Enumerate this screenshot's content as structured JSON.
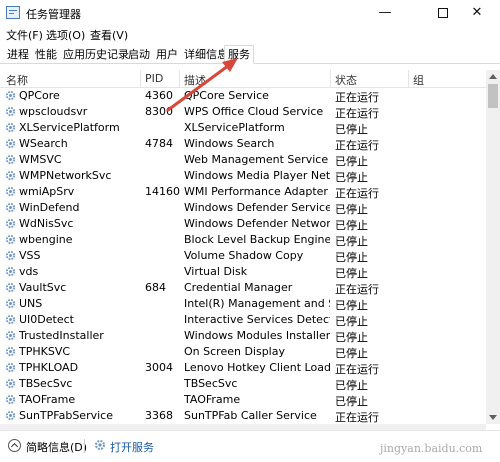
{
  "window": {
    "title": "任务管理器",
    "minimize": "—",
    "close": "✕"
  },
  "menu": [
    "文件(F)",
    "选项(O)",
    "查看(V)"
  ],
  "tabs": [
    "进程",
    "性能",
    "应用历史记录",
    "启动",
    "用户",
    "详细信息",
    "服务"
  ],
  "active_tab": "服务",
  "columns": {
    "name": "名称",
    "pid": "PID",
    "desc": "描述",
    "status": "状态",
    "group": "组"
  },
  "rows": [
    {
      "name": "QPCore",
      "pid": "4360",
      "desc": "QPCore Service",
      "status": "正在运行"
    },
    {
      "name": "wpscloudsvr",
      "pid": "8300",
      "desc": "WPS Office Cloud Service",
      "status": "正在运行"
    },
    {
      "name": "XLServicePlatform",
      "pid": "",
      "desc": "XLServicePlatform",
      "status": "已停止"
    },
    {
      "name": "WSearch",
      "pid": "4784",
      "desc": "Windows Search",
      "status": "正在运行"
    },
    {
      "name": "WMSVC",
      "pid": "",
      "desc": "Web Management Service",
      "status": "已停止"
    },
    {
      "name": "WMPNetworkSvc",
      "pid": "",
      "desc": "Windows Media Player Netw...",
      "status": "已停止"
    },
    {
      "name": "wmiApSrv",
      "pid": "14160",
      "desc": "WMI Performance Adapter",
      "status": "正在运行"
    },
    {
      "name": "WinDefend",
      "pid": "",
      "desc": "Windows Defender Service",
      "status": "已停止"
    },
    {
      "name": "WdNisSvc",
      "pid": "",
      "desc": "Windows Defender Network I...",
      "status": "已停止"
    },
    {
      "name": "wbengine",
      "pid": "",
      "desc": "Block Level Backup Engine Se...",
      "status": "已停止"
    },
    {
      "name": "VSS",
      "pid": "",
      "desc": "Volume Shadow Copy",
      "status": "已停止"
    },
    {
      "name": "vds",
      "pid": "",
      "desc": "Virtual Disk",
      "status": "已停止"
    },
    {
      "name": "VaultSvc",
      "pid": "684",
      "desc": "Credential Manager",
      "status": "正在运行"
    },
    {
      "name": "UNS",
      "pid": "",
      "desc": "Intel(R) Management and Sec...",
      "status": "已停止"
    },
    {
      "name": "UI0Detect",
      "pid": "",
      "desc": "Interactive Services Detection",
      "status": "已停止"
    },
    {
      "name": "TrustedInstaller",
      "pid": "",
      "desc": "Windows Modules Installer",
      "status": "已停止"
    },
    {
      "name": "TPHKSVC",
      "pid": "",
      "desc": "On Screen Display",
      "status": "已停止"
    },
    {
      "name": "TPHKLOAD",
      "pid": "3004",
      "desc": "Lenovo Hotkey Client Loader",
      "status": "正在运行"
    },
    {
      "name": "TBSecSvc",
      "pid": "",
      "desc": "TBSecSvc",
      "status": "已停止"
    },
    {
      "name": "TAOFrame",
      "pid": "",
      "desc": "TAOFrame",
      "status": "已停止"
    },
    {
      "name": "SunTPFabService",
      "pid": "3368",
      "desc": "SunTPFab Caller Service",
      "status": "正在运行"
    }
  ],
  "footer": {
    "fewer_details": "简略信息(D)",
    "open_services": "打开服务"
  },
  "watermark": "jingyan.baidu.com",
  "colors": {
    "accent_link": "#1a5aa6",
    "arrow": "#d9473a",
    "service_icon": "#6f97c5"
  }
}
